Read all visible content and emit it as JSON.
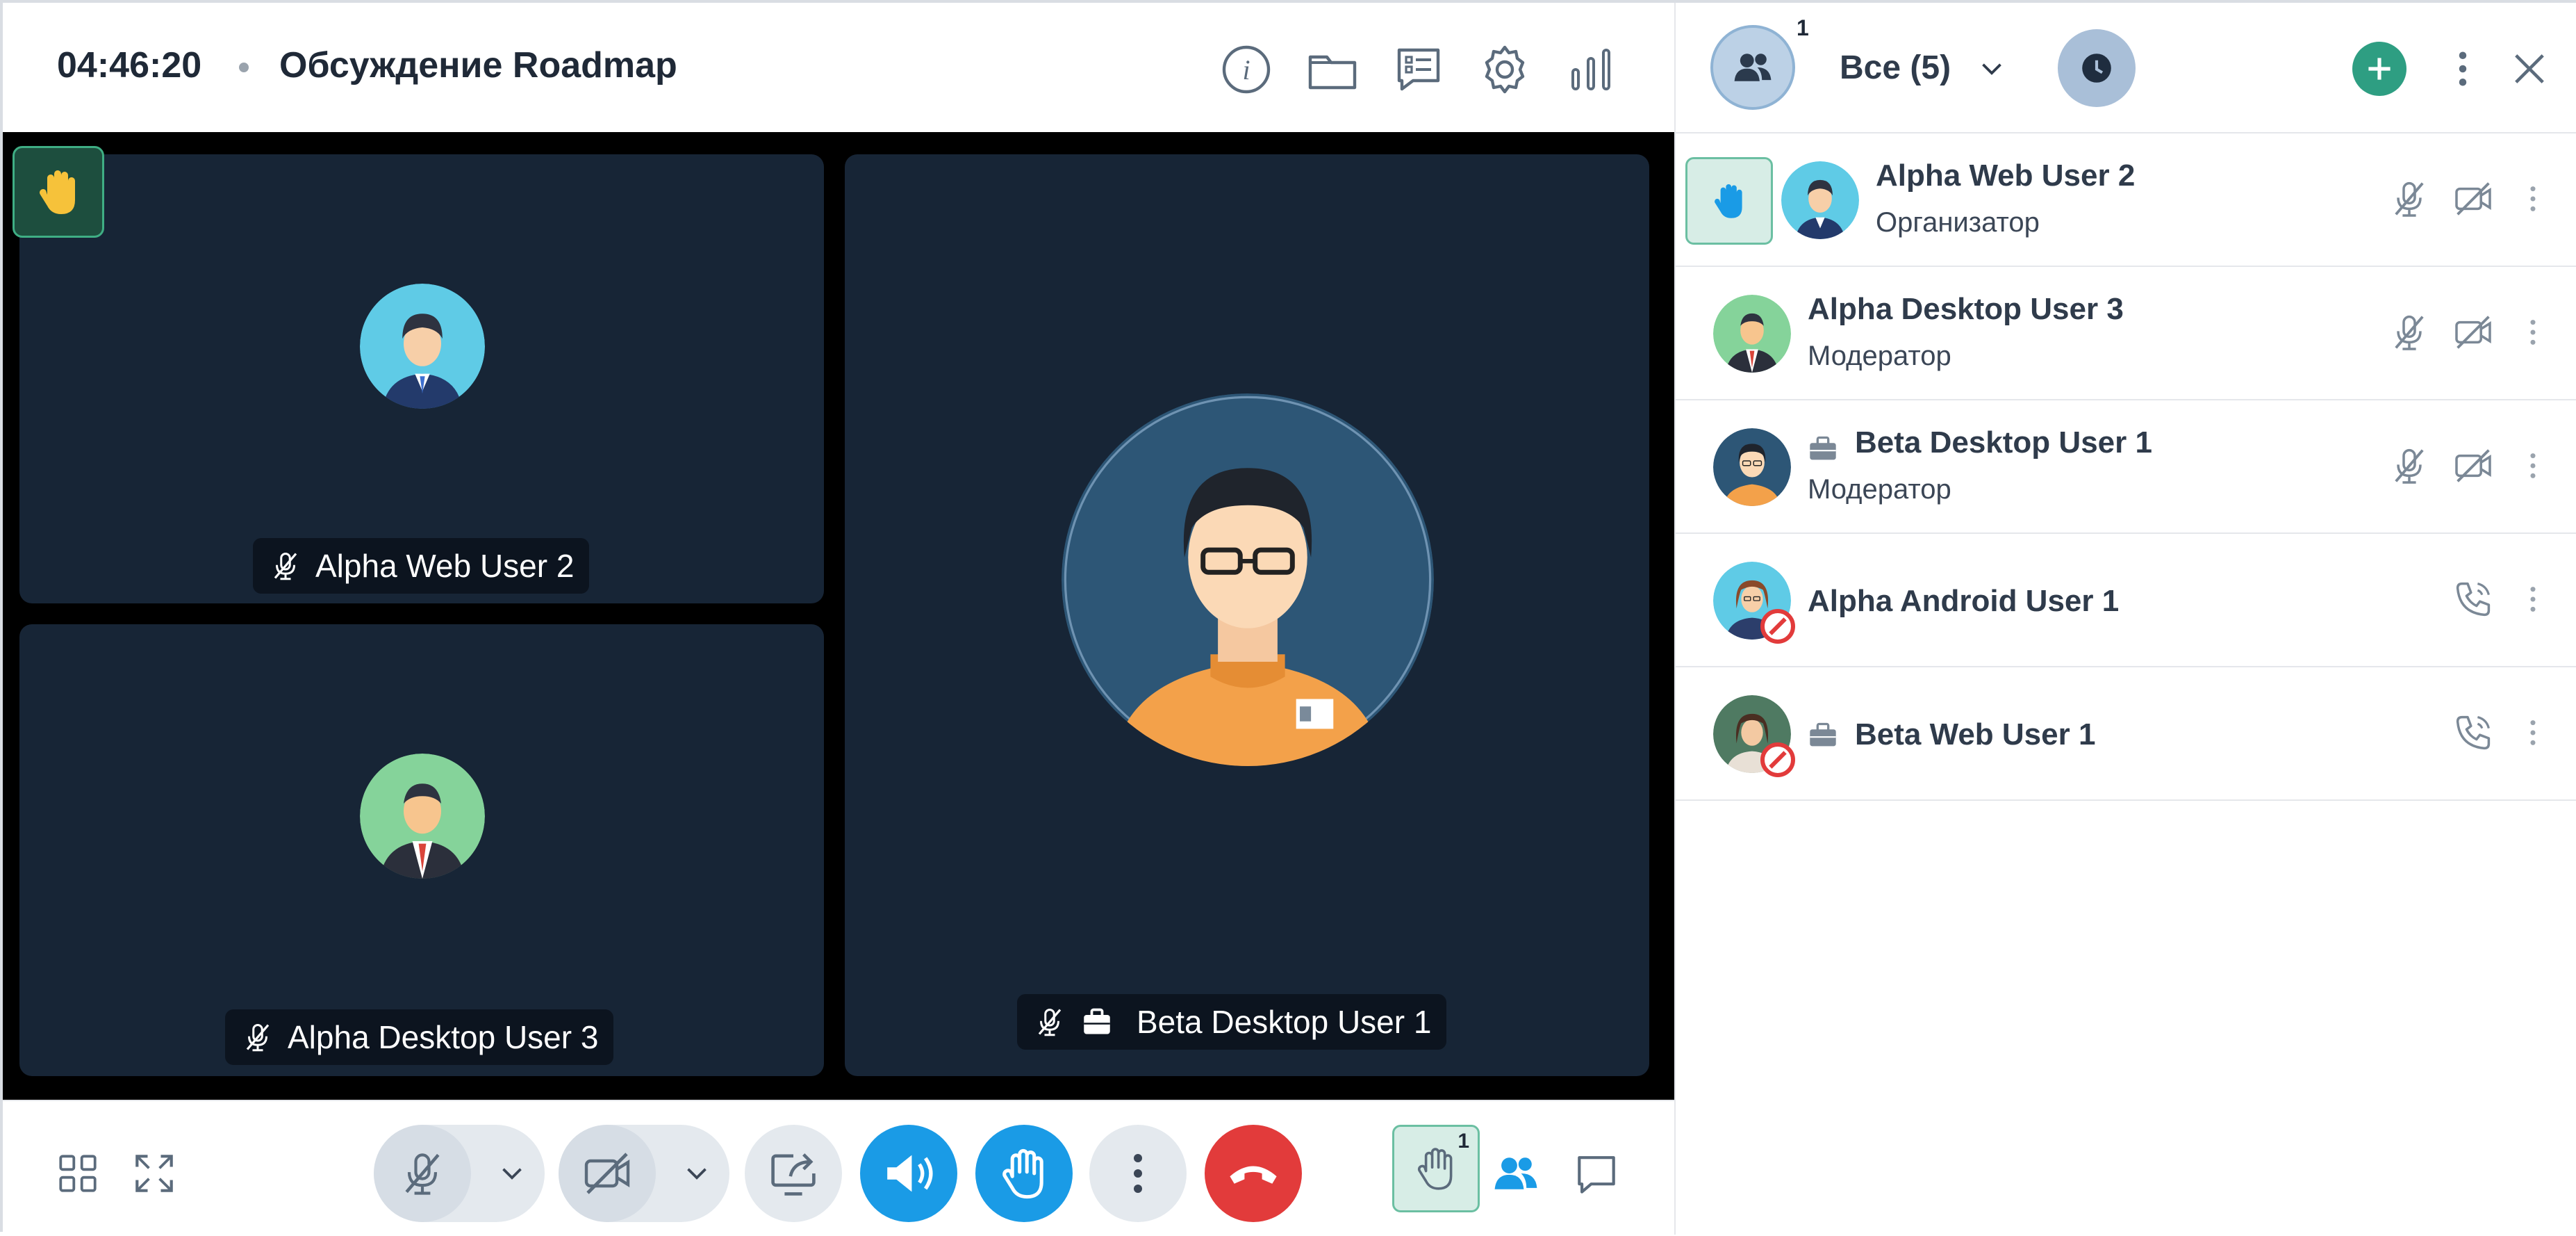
{
  "header": {
    "time": "04:46:20",
    "meeting_title": "Обсуждение Roadmap",
    "icons": [
      "info-icon",
      "folder-icon",
      "poll-icon",
      "settings-icon",
      "stats-icon"
    ]
  },
  "stage": {
    "raised_hand_icon": "hand-icon",
    "tiles": [
      {
        "name": "Alpha Web User 2",
        "muted": true
      },
      {
        "name": "Alpha Desktop User 3",
        "muted": true
      },
      {
        "name": "Beta Desktop User 1",
        "muted": true,
        "external": true
      }
    ]
  },
  "toolbar": {
    "hand_count": "1",
    "icons": [
      "grid-layout-icon",
      "fullscreen-icon",
      "mic-off-icon",
      "camera-off-icon",
      "share-screen-icon",
      "speaker-icon",
      "raise-hand-icon",
      "more-icon",
      "hang-up-icon",
      "hand-queue-icon",
      "participants-icon",
      "chat-icon"
    ]
  },
  "panel": {
    "participants_count_badge": "1",
    "filter_label": "Все (5)",
    "colors": {
      "accent": "#1a9be6",
      "hangup": "#e23b3b",
      "add": "#2e9e82",
      "tile": "#172536"
    },
    "participants": [
      {
        "name": "Alpha Web User 2",
        "role": "Организатор",
        "hand_raised": true,
        "mic_off": true,
        "cam_off": true
      },
      {
        "name": "Alpha Desktop User 3",
        "role": "Модератор",
        "mic_off": true,
        "cam_off": true
      },
      {
        "name": "Beta Desktop User 1",
        "role": "Модератор",
        "external": true,
        "mic_off": true,
        "cam_off": true
      },
      {
        "name": "Alpha Android User 1",
        "role": "",
        "call_only": true,
        "declined": true
      },
      {
        "name": "Beta Web User 1",
        "role": "",
        "external": true,
        "call_only": true,
        "declined": true
      }
    ]
  }
}
